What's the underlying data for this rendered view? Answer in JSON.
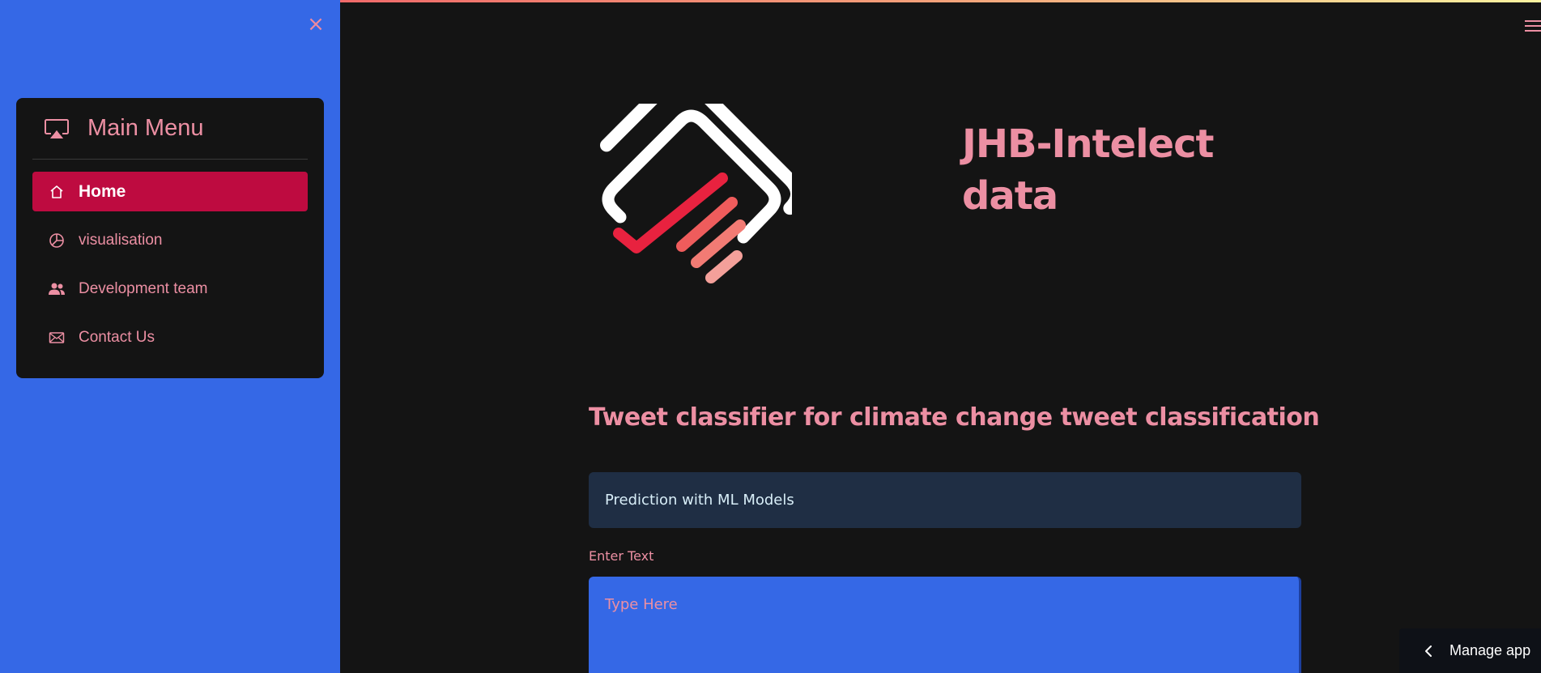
{
  "sidebar": {
    "close_symbol": "×",
    "menu": {
      "title": "Main Menu",
      "title_icon": "airplay-icon",
      "items": [
        {
          "label": "Home",
          "icon": "house-icon",
          "active": true
        },
        {
          "label": "visualisation",
          "icon": "pie-chart-icon",
          "active": false
        },
        {
          "label": "Development team",
          "icon": "people-icon",
          "active": false
        },
        {
          "label": "Contact Us",
          "icon": "envelope-icon",
          "active": false
        }
      ]
    }
  },
  "header": {
    "menu_icon": "hamburger-icon"
  },
  "main": {
    "app_title_line1": "JHB-Intelect",
    "app_title_line2": "data",
    "subtitle": "Tweet classifier for climate change tweet classification",
    "info_box": "Prediction with ML Models",
    "input_label": "Enter Text",
    "input_placeholder": "Type Here",
    "input_value": ""
  },
  "footer": {
    "manage_app_label": "Manage app"
  },
  "colors": {
    "sidebar_bg": "#3568E6",
    "page_bg": "#141414",
    "accent_pink": "#EC8FA3",
    "active_item": "#BE0B40",
    "info_bg": "#1F2E44"
  }
}
